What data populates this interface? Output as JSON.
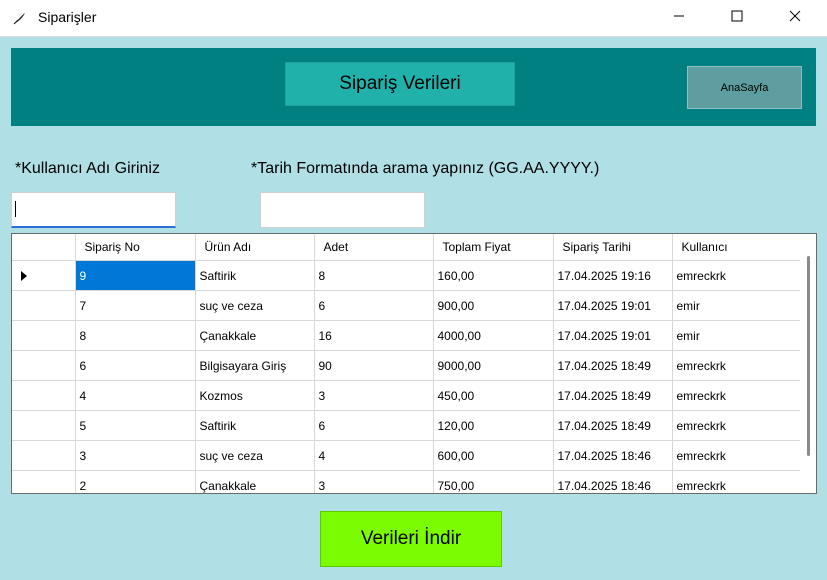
{
  "window": {
    "title": "Siparişler",
    "icons": {
      "app": "feather-icon",
      "minimize": "minimize-icon",
      "maximize": "maximize-icon",
      "close": "close-icon"
    }
  },
  "header": {
    "title": "Sipariş Verileri",
    "home_label": "AnaSayfa"
  },
  "filters": {
    "user_label": "*Kullanıcı Adı Giriniz",
    "user_value": "",
    "date_label": "*Tarih Formatında arama yapınız (GG.AA.YYYY.)",
    "date_value": ""
  },
  "table": {
    "columns": [
      "Sipariş No",
      "Ürün Adı",
      "Adet",
      "Toplam Fiyat",
      "Sipariş Tarihi",
      "Kullanıcı"
    ],
    "rows": [
      [
        "9",
        "Saftirik",
        "8",
        "160,00",
        "17.04.2025 19:16",
        "emreckrk"
      ],
      [
        "7",
        "suç ve ceza",
        "6",
        "900,00",
        "17.04.2025 19:01",
        "emir"
      ],
      [
        "8",
        "Çanakkale",
        "16",
        "4000,00",
        "17.04.2025 19:01",
        "emir"
      ],
      [
        "6",
        "Bilgisayara Giriş",
        "90",
        "9000,00",
        "17.04.2025 18:49",
        "emreckrk"
      ],
      [
        "4",
        "Kozmos",
        "3",
        "450,00",
        "17.04.2025 18:49",
        "emreckrk"
      ],
      [
        "5",
        "Saftirik",
        "6",
        "120,00",
        "17.04.2025 18:49",
        "emreckrk"
      ],
      [
        "3",
        "suç ve ceza",
        "4",
        "600,00",
        "17.04.2025 18:46",
        "emreckrk"
      ],
      [
        "2",
        "Çanakkale",
        "3",
        "750,00",
        "17.04.2025 18:46",
        "emreckrk"
      ]
    ],
    "selected_row": 0
  },
  "actions": {
    "download_label": "Verileri İndir"
  },
  "colors": {
    "background": "#b0dfe5",
    "header_band": "#008080",
    "header_title_bg": "#20b2aa",
    "home_button_bg": "#5f9ea0",
    "download_button_bg": "#7cfc00",
    "selection": "#0078d7"
  }
}
